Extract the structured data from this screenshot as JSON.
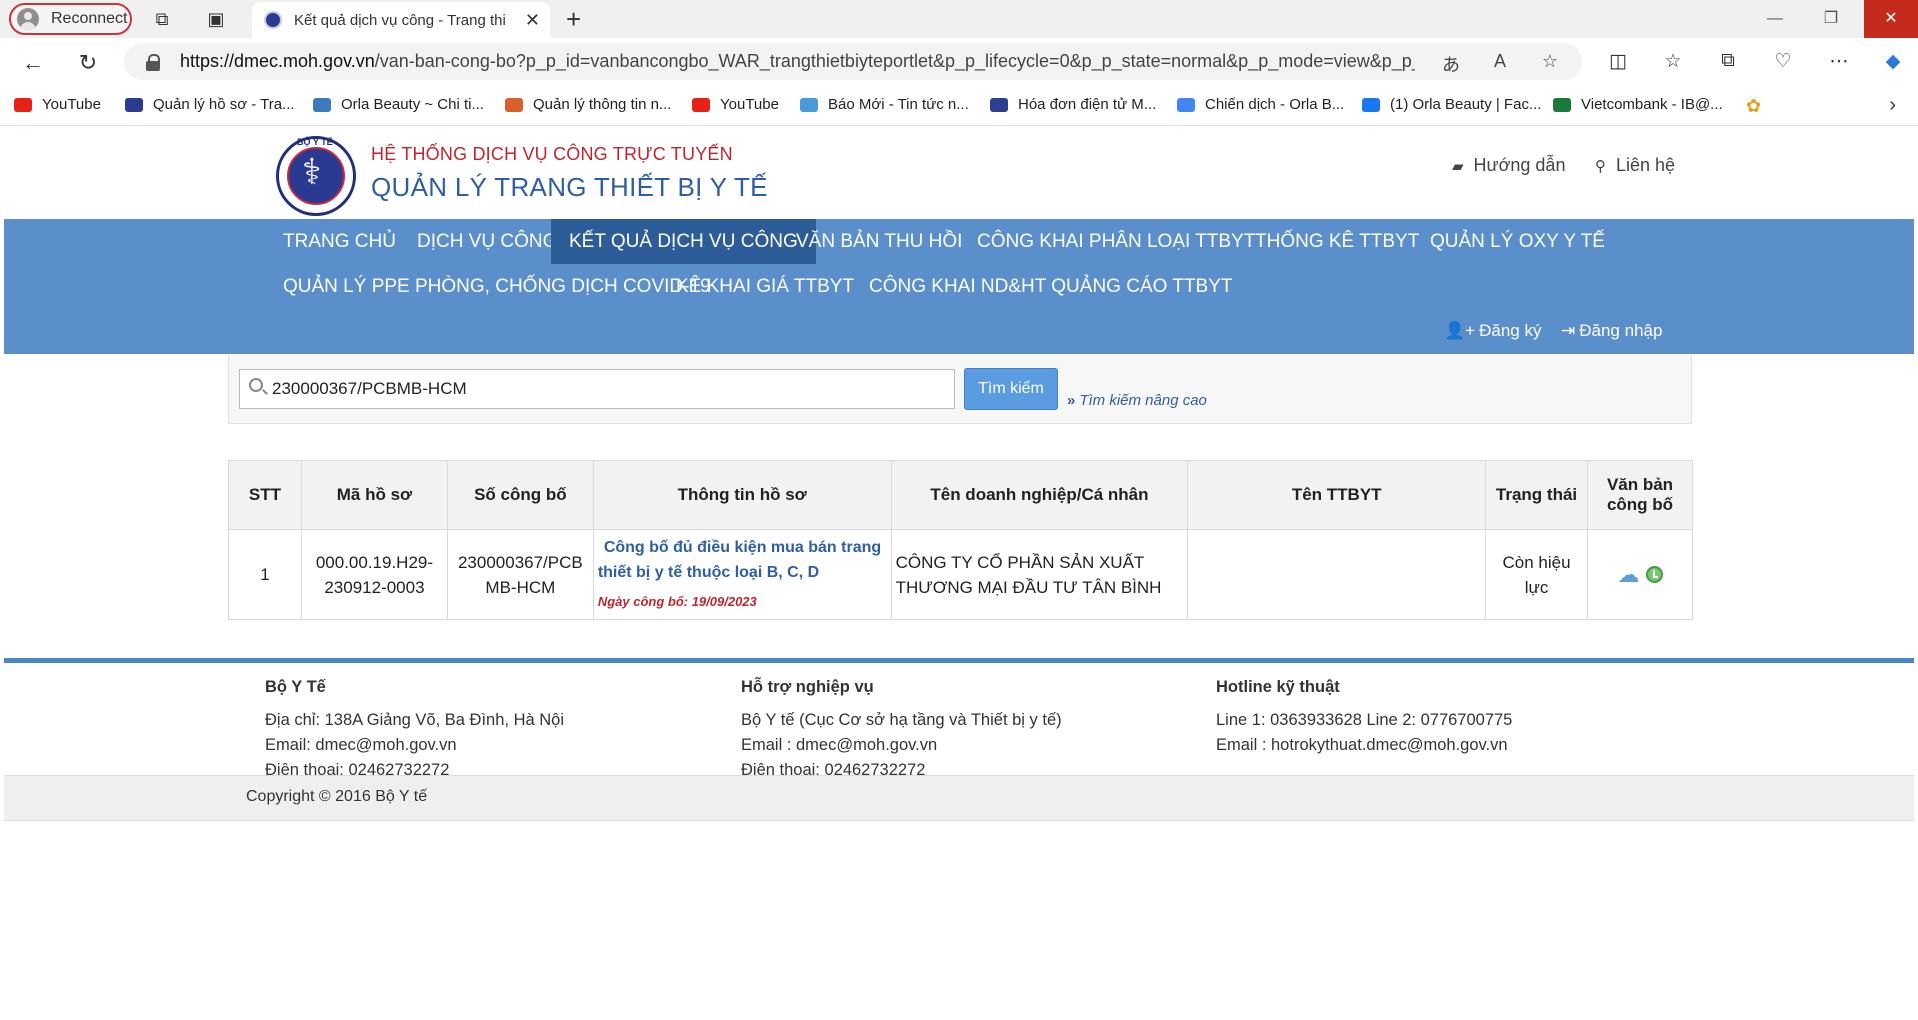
{
  "browser": {
    "profile_label": "Reconnect",
    "tab_title": "Kết quả dịch vụ công - Trang thi",
    "url_domain": "https://dmec.moh.gov.vn",
    "url_path": "/van-ban-cong-bo?p_p_id=vanbancongbo_WAR_trangthietbiyteportlet&p_p_lifecycle=0&p_p_state=normal&p_p_mode=view&p_p_c...",
    "bookmarks": [
      {
        "label": "YouTube",
        "color": "#e62117"
      },
      {
        "label": "Quản lý hồ sơ - Tra...",
        "color": "#2b3b8f"
      },
      {
        "label": "Orla Beauty ~ Chi ti...",
        "color": "#3b7bbf"
      },
      {
        "label": "Quản lý thông tin n...",
        "color": "#d9602a"
      },
      {
        "label": "YouTube",
        "color": "#e62117"
      },
      {
        "label": "Báo Mới - Tin tức n...",
        "color": "#4b9ad8"
      },
      {
        "label": "Hóa đơn điện tử M...",
        "color": "#2d3f8e"
      },
      {
        "label": "Chiến dịch - Orla B...",
        "color": "#4285f4"
      },
      {
        "label": "(1) Orla Beauty | Fac...",
        "color": "#1877f2"
      },
      {
        "label": "Vietcombank - IB@...",
        "color": "#1a7a3a"
      }
    ]
  },
  "header": {
    "logo_text": "BỘ Y TẾ",
    "subtitle": "HỆ THỐNG DỊCH VỤ CÔNG TRỰC TUYẾN",
    "title": "QUẢN LÝ TRANG THIẾT BỊ Y TẾ",
    "guide": "Hướng dẫn",
    "contact": "Liên hệ"
  },
  "nav": {
    "items": [
      "TRANG CHỦ",
      "DỊCH VỤ CÔNG",
      "KẾT QUẢ DỊCH VỤ CÔNG",
      "VĂN BẢN THU HỒI",
      "CÔNG KHAI PHÂN LOẠI TTBYT",
      "THỐNG KÊ TTBYT",
      "QUẢN LÝ OXY Y TẾ",
      "QUẢN LÝ PPE PHÒNG, CHỐNG DỊCH COVID-19",
      "KÊ KHAI GIÁ TTBYT",
      "CÔNG KHAI ND&HT QUẢNG CÁO TTBYT"
    ],
    "register": "Đăng ký",
    "login": "Đăng nhập"
  },
  "search": {
    "value": "230000367/PCBMB-HCM",
    "button": "Tìm kiếm",
    "advanced": "Tìm kiếm nâng cao"
  },
  "table": {
    "headers": [
      "STT",
      "Mã hồ sơ",
      "Số công bố",
      "Thông tin hồ sơ",
      "Tên doanh nghiệp/Cá nhân",
      "Tên TTBYT",
      "Trạng thái",
      "Văn bản công bố"
    ],
    "rows": [
      {
        "stt": "1",
        "ma_ho_so": "000.00.19.H29-230912-0003",
        "so_cong_bo": "230000367/PCBMB-HCM",
        "thong_tin": "Công bố đủ điều kiện mua bán trang thiết bị y tế thuộc loại B, C, D",
        "ngay_cong_bo": "Ngày công bố: 19/09/2023",
        "doanh_nghiep": "CÔNG TY CỔ PHẦN SẢN XUẤT THƯƠNG MẠI ĐẦU TƯ TÂN BÌNH",
        "ten_ttbyt": "",
        "trang_thai": "Còn hiệu lực"
      }
    ]
  },
  "footer": {
    "col1": {
      "title": "Bộ Y Tế",
      "lines": [
        "Địa chỉ: 138A Giảng Võ, Ba Đình, Hà Nội",
        "Email: dmec@moh.gov.vn",
        "Điện thoại: 02462732272"
      ]
    },
    "col2": {
      "title": "Hỗ trợ nghiệp vụ",
      "lines": [
        "Bộ Y tế (Cục Cơ sở hạ tầng và Thiết bị y tế)",
        "Email : dmec@moh.gov.vn",
        "Điện thoại: 02462732272"
      ]
    },
    "col3": {
      "title": "Hotline kỹ thuật",
      "lines": [
        "Line 1: 0363933628 Line 2: 0776700775",
        "Email : hotrokythuat.dmec@moh.gov.vn"
      ]
    },
    "copyright": "Copyright © 2016 Bộ Y tế"
  }
}
